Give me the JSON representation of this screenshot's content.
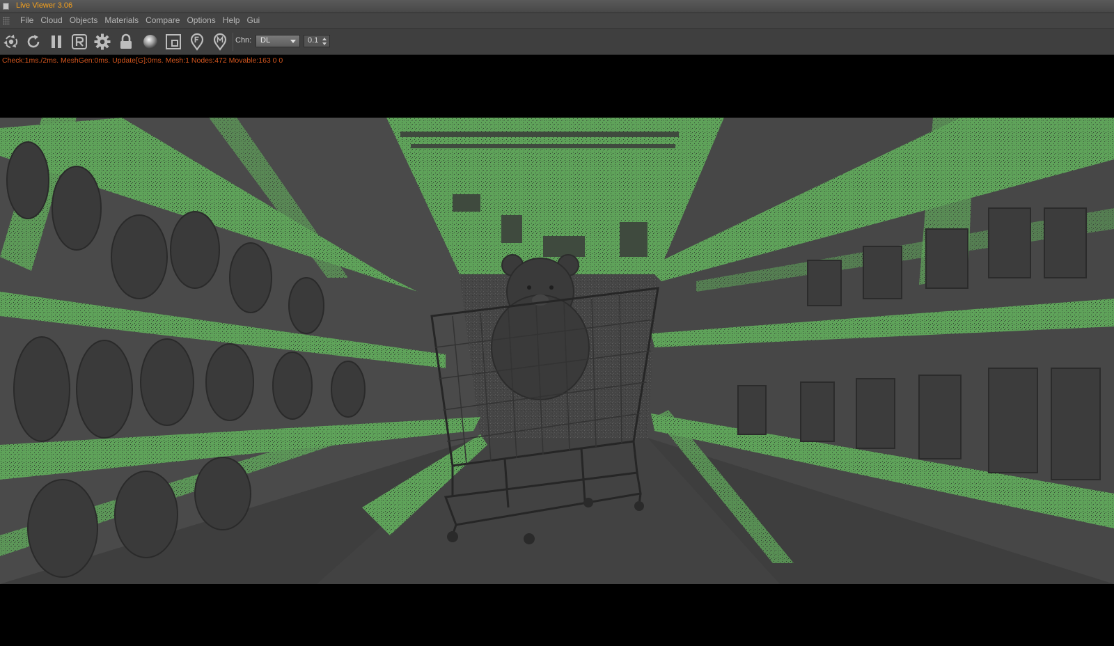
{
  "window": {
    "title": "Live Viewer 3.06",
    "title_color": "#f6a11c"
  },
  "menu": [
    "File",
    "Cloud",
    "Objects",
    "Materials",
    "Compare",
    "Options",
    "Help",
    "Gui"
  ],
  "toolbar": {
    "icons": [
      "recenter-icon",
      "refresh-icon",
      "pause-icon",
      "reset-r-icon",
      "settings-gear-icon",
      "lock-icon",
      "material-sphere-icon",
      "region-box-icon",
      "focus-pin-icon",
      "marker-pin-icon"
    ],
    "channel_label": "Chn:",
    "channel_value": "DL",
    "step_value": "0.1"
  },
  "status": {
    "text": "Check:1ms./2ms. MeshGen:0ms. Update[G]:0ms. Mesh:1 Nodes:472 Movable:163  0 0",
    "color": "#d2561f"
  },
  "viewport": {
    "content": "point-cloud-render",
    "cloud_color": "#5fa35a",
    "background": "#000000"
  }
}
